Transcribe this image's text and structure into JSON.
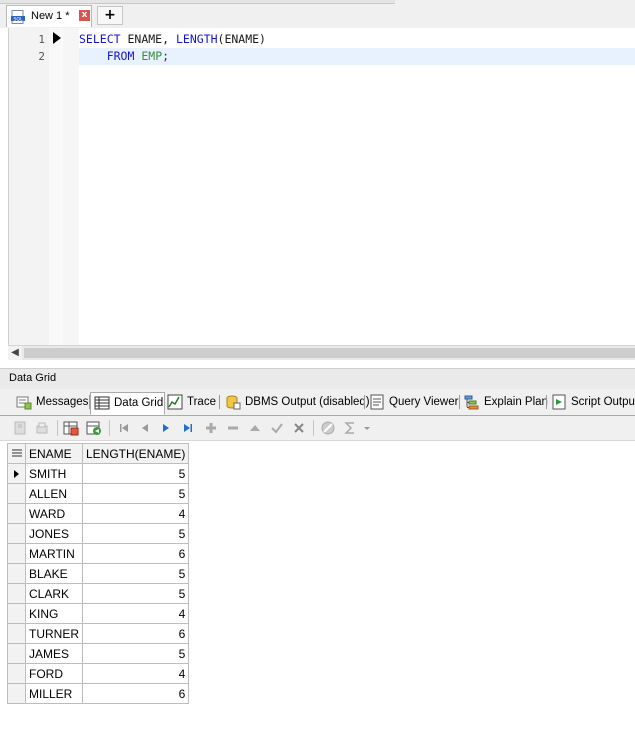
{
  "document_tab": {
    "label": "New 1 *",
    "icon": "sql-file-icon",
    "close": "x"
  },
  "new_tab": {
    "label": "+"
  },
  "editor": {
    "line_numbers": [
      "1",
      "2"
    ],
    "line1": {
      "select": "SELECT",
      "ename": "ENAME,",
      "length_fn": "LENGTH",
      "args": "(ENAME)"
    },
    "line2": {
      "indent": "    ",
      "from": "FROM",
      "table": "EMP",
      "semicolon": ";"
    }
  },
  "panel": {
    "title": "Data Grid"
  },
  "result_tabs": [
    {
      "label": "Messages",
      "icon": "messages-icon"
    },
    {
      "label": "Data Grid",
      "icon": "data-grid-icon"
    },
    {
      "label": "Trace",
      "icon": "trace-icon"
    },
    {
      "label": "DBMS Output (disabled)",
      "icon": "dbms-output-icon"
    },
    {
      "label": "Query Viewer",
      "icon": "query-viewer-icon"
    },
    {
      "label": "Explain Plan",
      "icon": "explain-plan-icon"
    },
    {
      "label": "Script Output",
      "icon": "script-output-icon"
    }
  ],
  "grid": {
    "columns": [
      "ENAME",
      "LENGTH(ENAME)"
    ],
    "rows": [
      {
        "ename": "SMITH",
        "length": "5"
      },
      {
        "ename": "ALLEN",
        "length": "5"
      },
      {
        "ename": "WARD",
        "length": "4"
      },
      {
        "ename": "JONES",
        "length": "5"
      },
      {
        "ename": "MARTIN",
        "length": "6"
      },
      {
        "ename": "BLAKE",
        "length": "5"
      },
      {
        "ename": "CLARK",
        "length": "5"
      },
      {
        "ename": "KING",
        "length": "4"
      },
      {
        "ename": "TURNER",
        "length": "6"
      },
      {
        "ename": "JAMES",
        "length": "5"
      },
      {
        "ename": "FORD",
        "length": "4"
      },
      {
        "ename": "MILLER",
        "length": "6"
      }
    ]
  },
  "colors": {
    "keyword": "#1515d8",
    "object": "#3c8c3c",
    "active_line": "#e8f2fe",
    "grid_border": "#bdbdbd"
  }
}
